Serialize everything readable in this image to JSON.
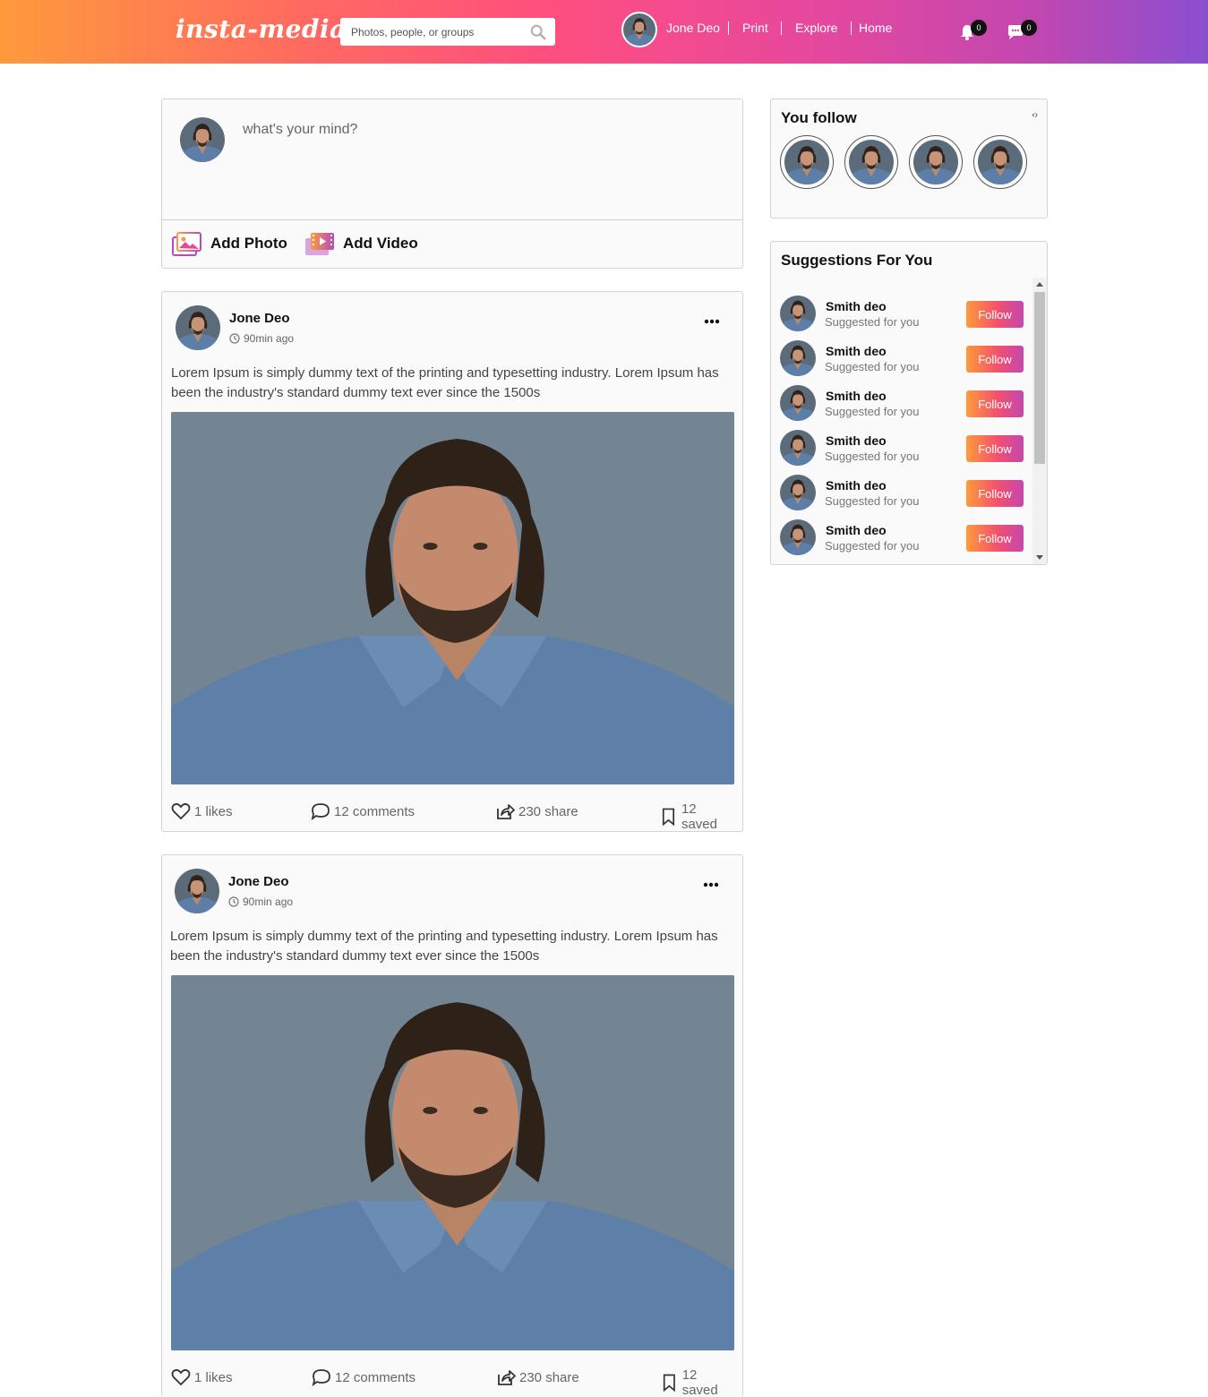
{
  "header": {
    "logo": "insta-media",
    "search_placeholder": "Photos, people, or groups",
    "user_name": "Jone Deo",
    "nav": [
      "Print",
      "Explore",
      "Home"
    ],
    "notifications_count": "0",
    "messages_count": "0"
  },
  "composer": {
    "placeholder": "what's your mind?",
    "add_photo": "Add Photo",
    "add_video": "Add Video"
  },
  "posts": [
    {
      "author": "Jone Deo",
      "time": "90min ago",
      "text": "Lorem Ipsum is simply dummy text of the printing and typesetting industry. Lorem Ipsum has been the industry's standard dummy text ever since the 1500s",
      "likes": "1 likes",
      "comments": "12 comments",
      "shares": "230 share",
      "saved": "12 saved"
    },
    {
      "author": "Jone Deo",
      "time": "90min ago",
      "text": "Lorem Ipsum is simply dummy text of the printing and typesetting industry. Lorem Ipsum has been the industry's standard dummy text ever since the 1500s",
      "likes": "1 likes",
      "comments": "12 comments",
      "shares": "230 share",
      "saved": "12 saved"
    }
  ],
  "sidebar": {
    "you_follow_title": "You follow",
    "carousel_arrows": "‹›",
    "suggestions_title": "Suggestions For You",
    "suggestions": [
      {
        "name": "Smith deo",
        "sub": "Suggested for you",
        "button": "Follow"
      },
      {
        "name": "Smith deo",
        "sub": "Suggested for you",
        "button": "Follow"
      },
      {
        "name": "Smith deo",
        "sub": "Suggested for you",
        "button": "Follow"
      },
      {
        "name": "Smith deo",
        "sub": "Suggested for you",
        "button": "Follow"
      },
      {
        "name": "Smith deo",
        "sub": "Suggested for you",
        "button": "Follow"
      },
      {
        "name": "Smith deo",
        "sub": "Suggested for you",
        "button": "Follow"
      }
    ]
  },
  "colors": {
    "header_gradient": [
      "#ff9a3c",
      "#ff4f7e",
      "#c447b0",
      "#8a4fd0"
    ],
    "follow_button": [
      "#ff9a3c",
      "#f2506f",
      "#c447b0"
    ]
  }
}
